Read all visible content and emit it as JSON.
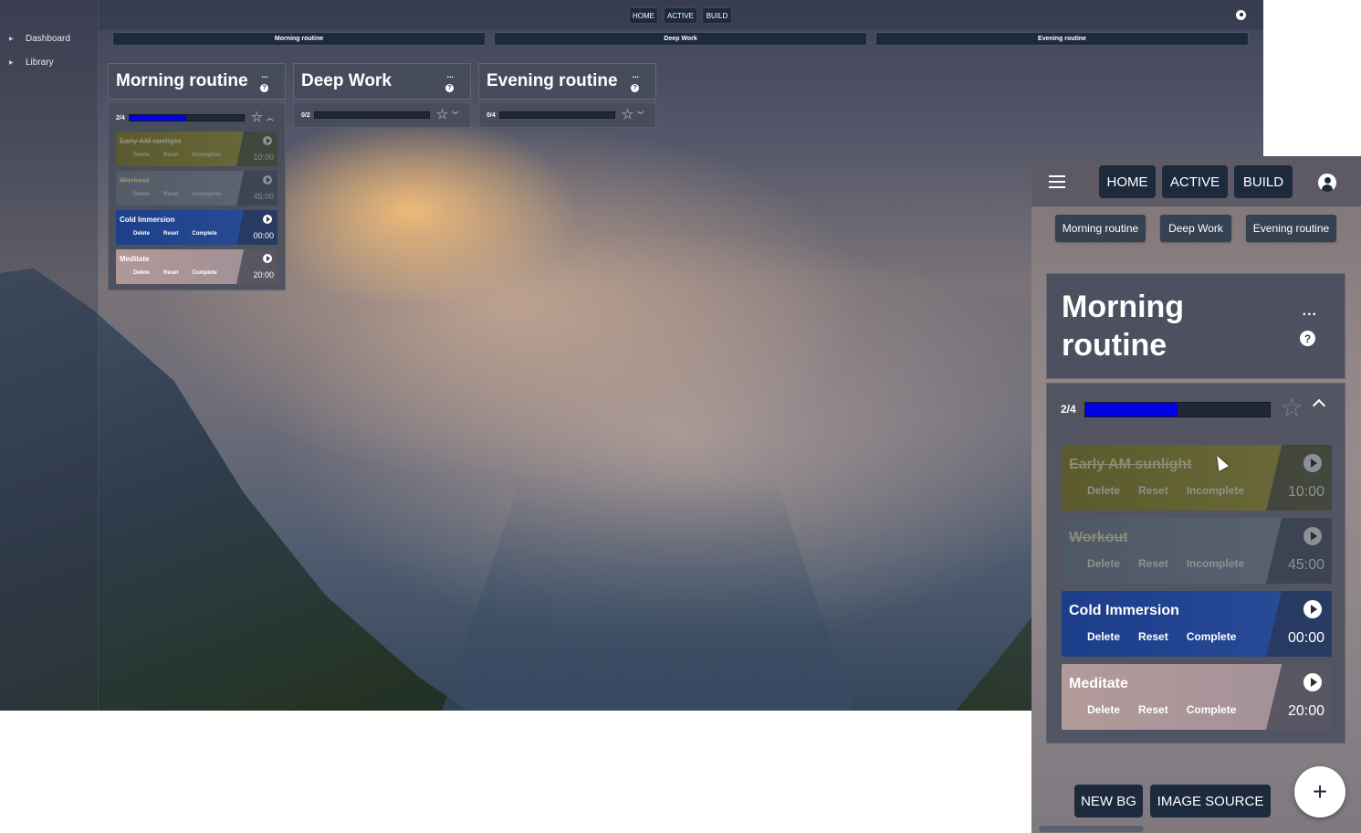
{
  "nav": {
    "sidebar": [
      {
        "label": "Dashboard"
      },
      {
        "label": "Library"
      }
    ],
    "buttons": {
      "home": "HOME",
      "active": "ACTIVE",
      "build": "BUILD"
    }
  },
  "tabs": [
    "Morning routine",
    "Deep Work",
    "Evening routine"
  ],
  "routines": [
    {
      "title": "Morning routine",
      "menu": "...",
      "help": "?",
      "progress_text": "2/4",
      "progress": 0.5,
      "tasks": [
        {
          "name": "Early AM sunlight",
          "actions": [
            "Delete",
            "Reset",
            "Incomplete"
          ],
          "time": "10:00",
          "done": true
        },
        {
          "name": "Workout",
          "actions": [
            "Delete",
            "Reset",
            "Incomplete"
          ],
          "time": "45:00",
          "done": true
        },
        {
          "name": "Cold Immersion",
          "actions": [
            "Delete",
            "Reset",
            "Complete"
          ],
          "time": "00:00",
          "done": false
        },
        {
          "name": "Meditate",
          "actions": [
            "Delete",
            "Reset",
            "Complete"
          ],
          "time": "20:00",
          "done": false
        }
      ]
    },
    {
      "title": "Deep Work",
      "menu": "...",
      "help": "?",
      "progress_text": "0/2",
      "progress": 0
    },
    {
      "title": "Evening routine",
      "menu": "...",
      "help": "?",
      "progress_text": "0/4",
      "progress": 0
    }
  ],
  "footer": {
    "new_bg": "NEW BG",
    "image_source": "IMAGE SOURCE",
    "fab": "+"
  },
  "icons": {
    "menu": "hamburger-icon",
    "user": "user-icon",
    "star": "star-icon",
    "collapse": "chevron-up-icon",
    "expand": "chevron-down-icon",
    "play": "play-icon",
    "help": "help-icon"
  },
  "colors": {
    "nav_button": "#1d2a3c",
    "progress_fill": "#0000e6",
    "task_early": "#5c5a2e",
    "task_workout": "#4f5a6a",
    "task_cold": "#1f3f8c",
    "task_meditate": "#a89090"
  }
}
